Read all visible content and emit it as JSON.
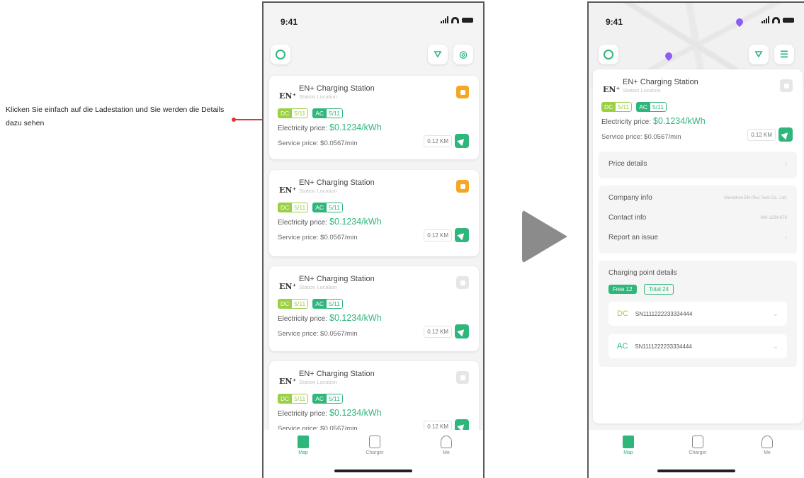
{
  "annotation": {
    "text": "Klicken Sie einfach auf die Ladestation und Sie werden die Details dazu sehen"
  },
  "status_bar": {
    "time": "9:41"
  },
  "station_list": {
    "cards": [
      {
        "name": "EN+ Charging Station",
        "location": "Station Location",
        "dc_label": "DC",
        "dc_count": "5/11",
        "ac_label": "AC",
        "ac_count": "5/11",
        "electricity_label": "Electricity price:",
        "electricity_price": "$0.1234/kWh",
        "service_text": "Service price: $0.0567/min",
        "distance": "0.12 KM",
        "favorite": true
      },
      {
        "name": "EN+ Charging Station",
        "location": "Station Location",
        "dc_label": "DC",
        "dc_count": "5/11",
        "ac_label": "AC",
        "ac_count": "5/11",
        "electricity_label": "Electricity price:",
        "electricity_price": "$0.1234/kWh",
        "service_text": "Service price: $0.0567/min",
        "distance": "0.12 KM",
        "favorite": true
      },
      {
        "name": "EN+ Charging Station",
        "location": "Station Location",
        "dc_label": "DC",
        "dc_count": "5/11",
        "ac_label": "AC",
        "ac_count": "5/11",
        "electricity_label": "Electricity price:",
        "electricity_price": "$0.1234/kWh",
        "service_text": "Service price: $0.0567/min",
        "distance": "0.12 KM",
        "favorite": false
      },
      {
        "name": "EN+ Charging Station",
        "location": "Station Location",
        "dc_label": "DC",
        "dc_count": "5/11",
        "ac_label": "AC",
        "ac_count": "5/11",
        "electricity_label": "Electricity price:",
        "electricity_price": "$0.1234/kWh",
        "service_text": "Service price: $0.0567/min",
        "distance": "0.12 KM",
        "favorite": false
      }
    ]
  },
  "tabbar": {
    "map": "Map",
    "charger": "Charger",
    "me": "Me"
  },
  "detail": {
    "station": {
      "name": "EN+ Charging Station",
      "location": "Station Location",
      "dc_label": "DC",
      "dc_count": "5/11",
      "ac_label": "AC",
      "ac_count": "5/11",
      "electricity_label": "Electricity price:",
      "electricity_price": "$0.1234/kWh",
      "service_text": "Service price: $0.0567/min",
      "distance": "0.12 KM"
    },
    "price_details": "Price details",
    "company_info_label": "Company info",
    "company_info_value": "Shenzhen EN Plus Tech Co., Ltd.",
    "contact_info_label": "Contact info",
    "contact_info_value": "400-1234-978",
    "report_issue": "Report an issue",
    "charging_point_title": "Charging point details",
    "free_label": "Free 12",
    "total_label": "Total 24",
    "points": [
      {
        "type": "DC",
        "serial": "SN1111222233334444"
      },
      {
        "type": "AC",
        "serial": "SN1111222233334444"
      }
    ]
  },
  "colors": {
    "accent": "#2fb67c",
    "dc": "#9bcf45",
    "favorite": "#f5a623",
    "arrow": "#e3332f"
  }
}
